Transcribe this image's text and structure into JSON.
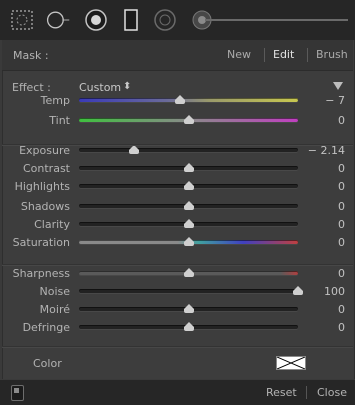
{
  "toolbar": {
    "tools": [
      "spot-removal-icon",
      "radial-filter-icon",
      "brush-tool-icon",
      "graduated-filter-icon",
      "adjustment-brush-icon"
    ],
    "top_slider_value": 0
  },
  "mask": {
    "label": "Mask :",
    "new_label": "New",
    "edit_label": "Edit",
    "brush_label": "Brush",
    "active": "Edit"
  },
  "effect": {
    "label": "Effect :",
    "value": "Custom",
    "arrows": "⬍"
  },
  "sliders": {
    "temp": {
      "label": "Temp",
      "value": "− 7",
      "position": 0.46
    },
    "tint": {
      "label": "Tint",
      "value": "0",
      "position": 0.5
    },
    "exposure": {
      "label": "Exposure",
      "value": "− 2.14",
      "position": 0.25
    },
    "contrast": {
      "label": "Contrast",
      "value": "0",
      "position": 0.5
    },
    "highlights": {
      "label": "Highlights",
      "value": "0",
      "position": 0.5
    },
    "shadows": {
      "label": "Shadows",
      "value": "0",
      "position": 0.5
    },
    "clarity": {
      "label": "Clarity",
      "value": "0",
      "position": 0.5
    },
    "saturation": {
      "label": "Saturation",
      "value": "0",
      "position": 0.5
    },
    "sharpness": {
      "label": "Sharpness",
      "value": "0",
      "position": 0.5
    },
    "noise": {
      "label": "Noise",
      "value": "100",
      "position": 1.0
    },
    "moire": {
      "label": "Moiré",
      "value": "0",
      "position": 0.5
    },
    "defringe": {
      "label": "Defringe",
      "value": "0",
      "position": 0.5
    }
  },
  "color": {
    "label": "Color",
    "swatch": "#ffffff"
  },
  "footer": {
    "reset_label": "Reset",
    "close_label": "Close"
  },
  "colors": {
    "temp_gradient": [
      "#3a3ab8",
      "#c8c850"
    ],
    "tint_gradient": [
      "#3fc03f",
      "#c040c0"
    ],
    "saturation_gradient": [
      "#8a8a8a",
      "#c04040"
    ],
    "sharpness_accent": "#b04040"
  }
}
